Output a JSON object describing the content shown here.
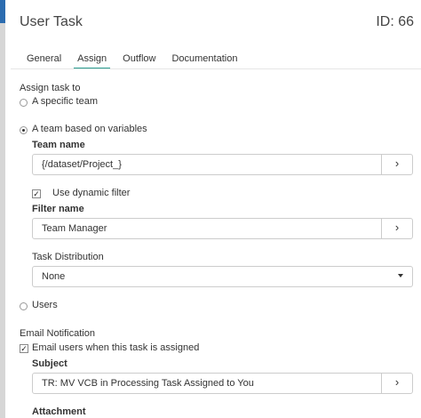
{
  "header": {
    "title": "User Task",
    "id_label": "ID: 66"
  },
  "tabs": [
    {
      "label": "General"
    },
    {
      "label": "Assign"
    },
    {
      "label": "Outflow"
    },
    {
      "label": "Documentation"
    }
  ],
  "active_tab": "Assign",
  "assign": {
    "section_label": "Assign task to",
    "options": [
      {
        "label": "A specific team",
        "checked": false
      },
      {
        "label": "A team based on variables",
        "checked": true
      },
      {
        "label": "Users",
        "checked": false
      }
    ],
    "team_name_label": "Team name",
    "team_name_value": "{/dataset/Project_}",
    "use_dynamic_filter_label": "Use dynamic filter",
    "use_dynamic_filter_checked": true,
    "filter_name_label": "Filter name",
    "filter_name_value": "Team Manager",
    "task_distribution_label": "Task Distribution",
    "task_distribution_value": "None"
  },
  "email": {
    "section_label": "Email Notification",
    "checkbox_label": "Email users when this task is assigned",
    "checked": true,
    "subject_label": "Subject",
    "subject_value": "TR: MV VCB in Processing Task Assigned to You",
    "attachment_label": "Attachment"
  },
  "icons": {
    "picker": "chevron-right-icon",
    "dropdown": "caret-down-icon"
  },
  "colors": {
    "active_tab_underline": "#2a9d8f"
  }
}
